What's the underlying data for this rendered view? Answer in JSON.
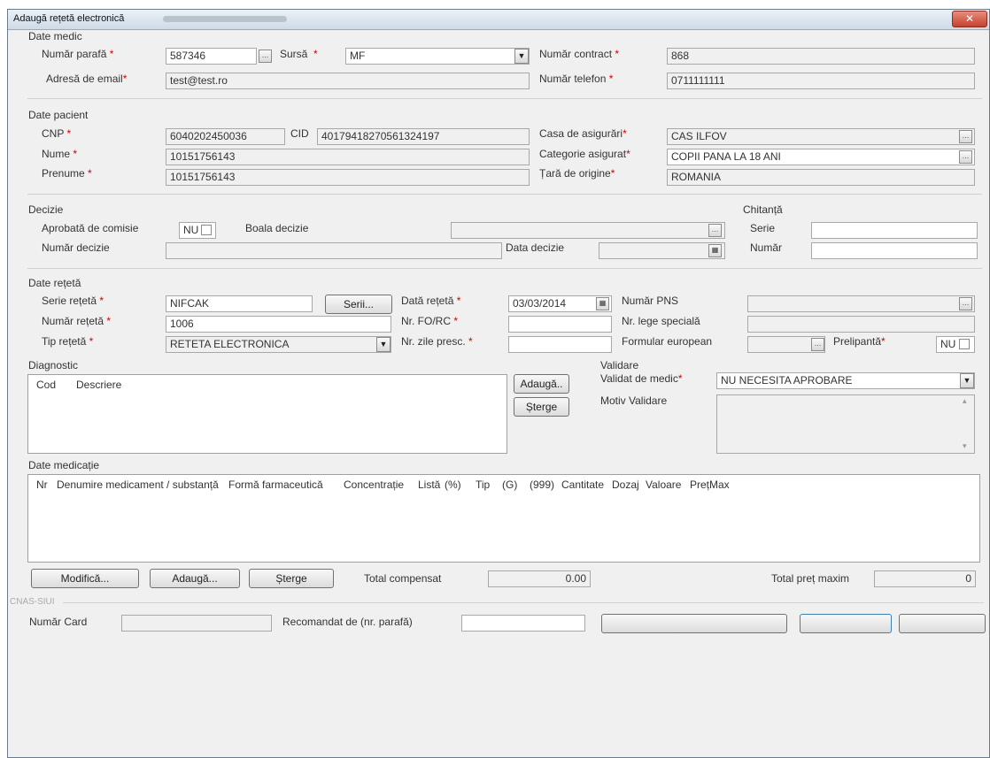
{
  "window": {
    "title": "Adaugă rețetă electronică",
    "close_label": "✕"
  },
  "doctor": {
    "group_title": "Date medic",
    "parafa_label": "Număr parafă",
    "parafa_value": "587346",
    "source_label": "Sursă",
    "source_value": "MF",
    "contract_label": "Număr contract",
    "contract_value": "868",
    "email_label": "Adresă de email",
    "email_value": "test@test.ro",
    "phone_label": "Număr telefon",
    "phone_value": "0711111111"
  },
  "patient": {
    "group_title": "Date pacient",
    "cnp_label": "CNP",
    "cnp_value": "6040202450036",
    "cid_label": "CID",
    "cid_value": "40179418270561324197",
    "insurer_label": "Casa de asigurări",
    "insurer_value": "CAS ILFOV",
    "lastname_label": "Nume",
    "lastname_value": "10151756143",
    "category_label": "Categorie asigurat",
    "category_value": "COPII PANA LA 18 ANI",
    "firstname_label": "Prenume",
    "firstname_value": "10151756143",
    "country_label": "Țară de origine",
    "country_value": "ROMANIA"
  },
  "decision": {
    "group_title": "Decizie",
    "approved_label": "Aprobată de comisie",
    "approved_value": "NU",
    "disease_label": "Boala decizie",
    "number_label": "Număr decizie",
    "date_label": "Data decizie"
  },
  "receipt": {
    "group_title": "Chitanță",
    "series_label": "Serie",
    "number_label": "Număr"
  },
  "prescription": {
    "group_title": "Date rețetă",
    "series_label": "Serie rețetă",
    "series_value": "NIFCAK",
    "series_button": "Serii...",
    "date_label": "Dată rețetă",
    "date_value": "03/03/2014",
    "pns_label": "Număr PNS",
    "number_label": "Număr rețetă",
    "number_value": "1006",
    "fo_label": "Nr. FO/RC",
    "special_law_label": "Nr. lege specială",
    "type_label": "Tip rețetă",
    "type_value": "RETETA ELECTRONICA",
    "days_label": "Nr. zile presc.",
    "euform_label": "Formular european",
    "prelim_label": "Prelipantă",
    "prelim_value": "NU"
  },
  "diagnosis": {
    "group_title": "Diagnostic",
    "col_code": "Cod",
    "col_desc": "Descriere",
    "add_button": "Adaugă..",
    "delete_button": "Șterge"
  },
  "validation": {
    "group_title": "Validare",
    "validated_label": "Validat de medic",
    "validated_value": "NU NECESITA APROBARE",
    "reason_label": "Motiv Validare"
  },
  "medication": {
    "group_title": "Date medicație",
    "columns": [
      "Nr",
      "Denumire medicament / substanță",
      "Formă farmaceutică",
      "Concentrație",
      "Listă",
      "(%)",
      "Tip",
      "(G)",
      "(999)",
      "Cantitate",
      "Dozaj",
      "Valoare",
      "PrețMax"
    ],
    "modify_button": "Modifică...",
    "add_button": "Adaugă...",
    "delete_button": "Șterge",
    "total_comp_label": "Total compensat",
    "total_comp_value": "0.00",
    "total_max_label": "Total preț maxim",
    "total_max_value": "0"
  },
  "footer": {
    "group_title": "CNAS-SIUI",
    "card_label": "Număr Card",
    "recommended_label": "Recomandat de (nr. parafă)"
  },
  "icons": {
    "ellipsis": "…",
    "dropdown": "▼",
    "calendar": "▦",
    "scroll_up": "▴",
    "scroll_down": "▾"
  }
}
